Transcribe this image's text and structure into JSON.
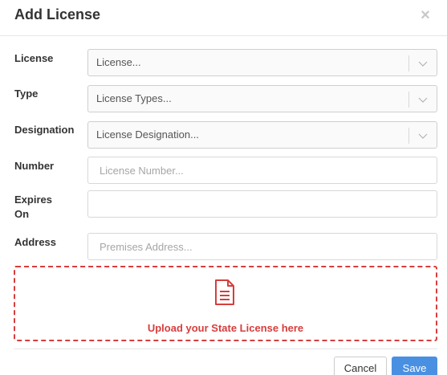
{
  "modal": {
    "title": "Add License",
    "close_glyph": "×"
  },
  "fields": {
    "license": {
      "label": "License",
      "placeholder": "License..."
    },
    "type": {
      "label": "Type",
      "placeholder": "License Types..."
    },
    "designation": {
      "label": "Designation",
      "placeholder": "License Designation..."
    },
    "number": {
      "label": "Number",
      "placeholder": "License Number...",
      "value": ""
    },
    "expires_on": {
      "label_line1": "Expires",
      "label_line2": "On",
      "value": ""
    },
    "address": {
      "label": "Address",
      "placeholder": "Premises Address...",
      "value": ""
    }
  },
  "upload": {
    "text": "Upload your State License here",
    "icon": "document-icon"
  },
  "footer": {
    "cancel_label": "Cancel",
    "save_label": "Save"
  },
  "colors": {
    "accent_red": "#d73d3d",
    "primary_blue": "#4a90e2",
    "close_gray": "#c8c8c8"
  }
}
